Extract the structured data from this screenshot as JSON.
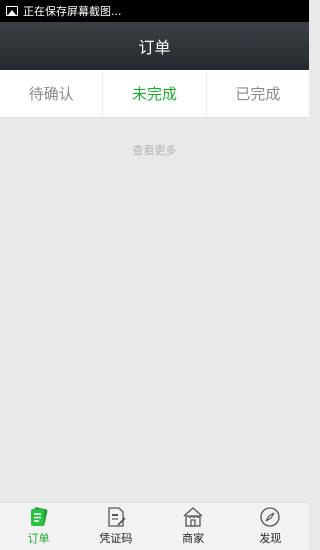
{
  "status_bar": {
    "text": "正在保存屏幕截图...",
    "icon": "image-icon"
  },
  "header": {
    "title": "订单"
  },
  "tabs": [
    {
      "label": "待确认",
      "active": false
    },
    {
      "label": "未完成",
      "active": true
    },
    {
      "label": "已完成",
      "active": false
    }
  ],
  "content": {
    "load_more": "查看更多"
  },
  "bottom_nav": [
    {
      "label": "订单",
      "icon": "orders-icon",
      "active": true
    },
    {
      "label": "凭证码",
      "icon": "voucher-icon",
      "active": false
    },
    {
      "label": "商家",
      "icon": "store-icon",
      "active": false
    },
    {
      "label": "发现",
      "icon": "compass-icon",
      "active": false
    }
  ],
  "colors": {
    "accent": "#20a836",
    "header_bg": "#2f3438"
  }
}
